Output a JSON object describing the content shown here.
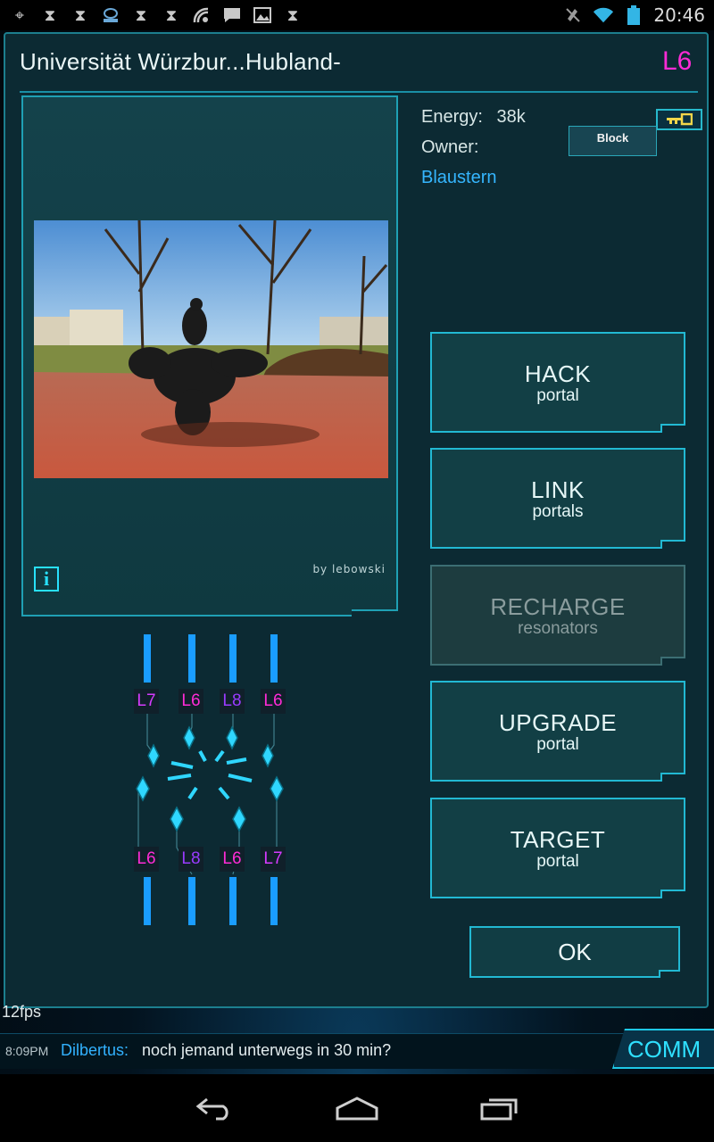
{
  "status_bar": {
    "time": "20:46",
    "left_icons": [
      "gps-icon",
      "hourglass-icon",
      "hourglass-icon",
      "ingress-icon",
      "hourglass-icon",
      "hourglass-icon",
      "signal-icon",
      "chat-icon",
      "image-icon",
      "hourglass-icon"
    ],
    "right_icons": [
      "vibrate-off-icon",
      "wifi-icon",
      "battery-icon"
    ]
  },
  "portal": {
    "title": "Universität Würzbur...Hubland-",
    "level": "L6",
    "energy_label": "Energy:",
    "energy_value": "38k",
    "owner_label": "Owner:",
    "owner_name": "Blaustern",
    "block_label": "Block",
    "photo_credit": "by lebowski",
    "info_label": "i"
  },
  "actions": [
    {
      "big": "HACK",
      "small": "portal",
      "enabled": true
    },
    {
      "big": "LINK",
      "small": "portals",
      "enabled": true
    },
    {
      "big": "RECHARGE",
      "small": "resonators",
      "enabled": false
    },
    {
      "big": "UPGRADE",
      "small": "portal",
      "enabled": true
    },
    {
      "big": "TARGET",
      "small": "portal",
      "enabled": true
    }
  ],
  "ok_label": "OK",
  "resonators": {
    "top": [
      "L7",
      "L6",
      "L8",
      "L6"
    ],
    "bottom": [
      "L6",
      "L8",
      "L6",
      "L7"
    ]
  },
  "chat": {
    "fps": "12fps",
    "time": "8:09PM",
    "user": "Dilbertus:",
    "message": "noch jemand unterwegs in 30 min?",
    "comm_label": "COMM"
  },
  "colors": {
    "accent": "#22b9d3",
    "level_magenta": "#ff2bd6",
    "owner_blue": "#35b6ff",
    "reso_L6": "#ff2bd6",
    "reso_L7": "#d63bff",
    "reso_L8": "#9a3bff"
  }
}
